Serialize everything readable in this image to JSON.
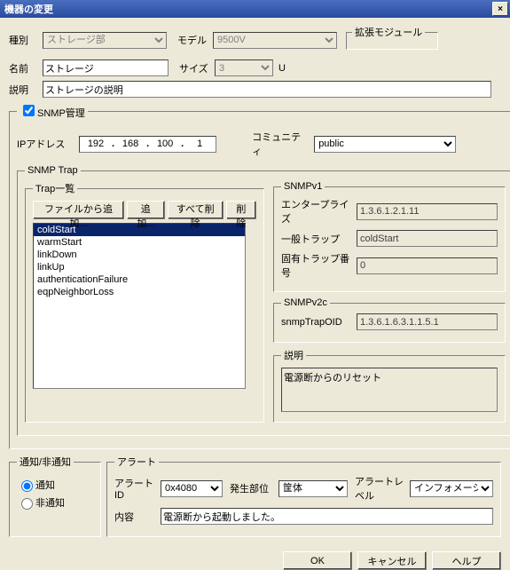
{
  "title": "機器の変更",
  "close_x": "×",
  "labels": {
    "type": "種別",
    "model": "モデル",
    "name": "名前",
    "size": "サイズ",
    "unit": "U",
    "desc": "説明",
    "ext": "拡張モジュール",
    "snmp_mgmt": "SNMP管理",
    "ip": "IPアドレス",
    "community": "コミュニティ",
    "snmp_trap": "SNMP Trap",
    "trap_list": "Trap一覧",
    "add_from_file": "ファイルから追加...",
    "add": "追加...",
    "del_all": "すべて削除",
    "del": "削除",
    "snmpv1": "SNMPv1",
    "enterprise": "エンタープライズ",
    "generic_trap": "一般トラップ",
    "specific_trap": "固有トラップ番号",
    "snmpv2c": "SNMPv2c",
    "trap_oid": "snmpTrapOID",
    "trap_desc": "説明",
    "notice": "通知/非通知",
    "notify": "通知",
    "no_notify": "非通知",
    "alert": "アラート",
    "alert_id": "アラートID",
    "occur": "発生部位",
    "alert_level": "アラートレベル",
    "content": "内容",
    "ok": "OK",
    "cancel": "キャンセル",
    "help": "ヘルプ"
  },
  "vals": {
    "type": "ストレージ部",
    "model": "9500V",
    "name": "ストレージ",
    "size": "3",
    "desc": "ストレージの説明",
    "ip": [
      "192",
      "168",
      "100",
      "1"
    ],
    "community": "public",
    "traps": [
      "coldStart",
      "warmStart",
      "linkDown",
      "linkUp",
      "authenticationFailure",
      "eqpNeighborLoss"
    ],
    "trap_selected": 0,
    "enterprise": "1.3.6.1.2.1.11",
    "generic_trap": "coldStart",
    "specific_trap": "0",
    "trap_oid": "1.3.6.1.6.3.1.1.5.1",
    "trap_desc": "電源断からのリセット",
    "alert_id": "0x4080",
    "occur": "筐体",
    "alert_level": "インフォメーション",
    "content": "電源断から起動しました。"
  }
}
